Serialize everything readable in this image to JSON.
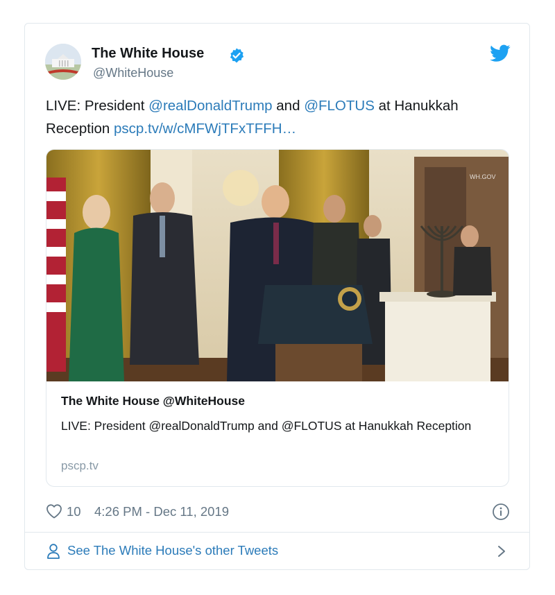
{
  "tweet": {
    "author_name": "The White House",
    "handle": "@WhiteHouse",
    "text_prefix": "LIVE: President ",
    "mention_1": "@realDonaldTrump",
    "text_and": " and ",
    "mention_2": "@FLOTUS",
    "text_suffix": " at Hanukkah Reception ",
    "link": "pscp.tv/w/cMFWjTFxTFFH…"
  },
  "media_card": {
    "title": "The White House @WhiteHouse",
    "description": "LIVE: President @realDonaldTrump and @FLOTUS at Hanukkah Reception",
    "domain": "pscp.tv",
    "watermark": "WH.GOV"
  },
  "footer": {
    "like_count": "10",
    "timestamp": "4:26 PM - Dec 11, 2019",
    "see_other": "See The White House's other Tweets"
  },
  "icons": {
    "verified": "verified-badge-icon",
    "bird": "twitter-bird-icon",
    "heart": "heart-icon",
    "info": "info-icon",
    "person": "person-icon",
    "chevron": "chevron-right-icon"
  },
  "colors": {
    "link": "#2b7bb9",
    "text": "#14171a",
    "secondary": "#657786",
    "verified": "#1da1f2",
    "border": "#e1e8ed"
  }
}
